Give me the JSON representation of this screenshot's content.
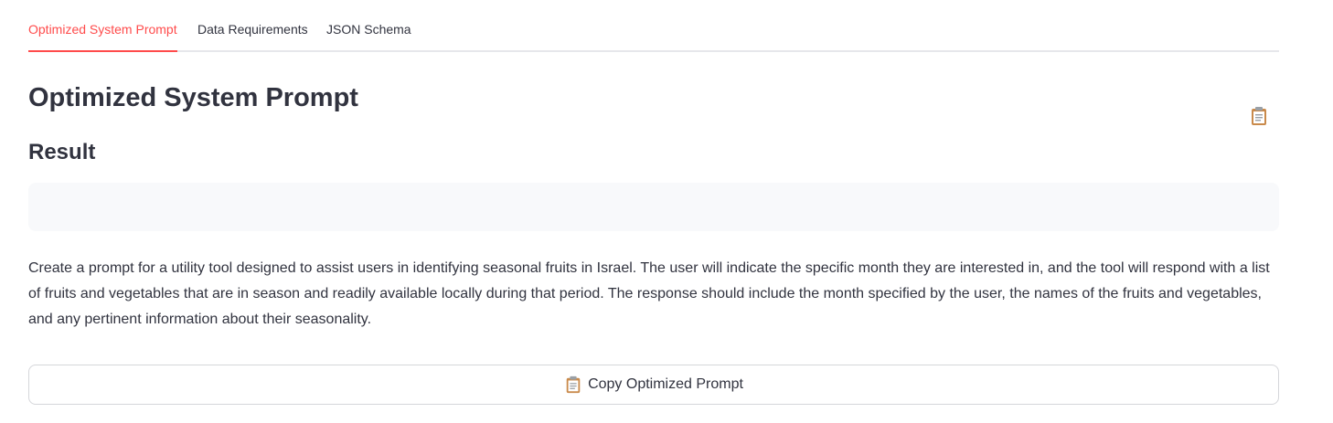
{
  "tabs": [
    {
      "label": "Optimized System Prompt",
      "active": true
    },
    {
      "label": "Data Requirements",
      "active": false
    },
    {
      "label": "JSON Schema",
      "active": false
    }
  ],
  "main": {
    "title": "Optimized System Prompt",
    "result_heading": "Result",
    "code_block": "",
    "prompt_text": "Create a prompt for a utility tool designed to assist users in identifying seasonal fruits in Israel. The user will indicate the specific month they are interested in, and the tool will respond with a list of fruits and vegetables that are in season and readily available locally during that period. The response should include the month specified by the user, the names of the fruits and vegetables, and any pertinent information about their seasonality.",
    "copy_button_label": "Copy Optimized Prompt"
  },
  "icons": {
    "copy": "clipboard-icon",
    "button_icon": "clipboard-icon"
  },
  "colors": {
    "accent": "#ff4b4b",
    "text": "#31333f",
    "code_bg": "#f8f9fb",
    "border": "#d5d6da"
  }
}
